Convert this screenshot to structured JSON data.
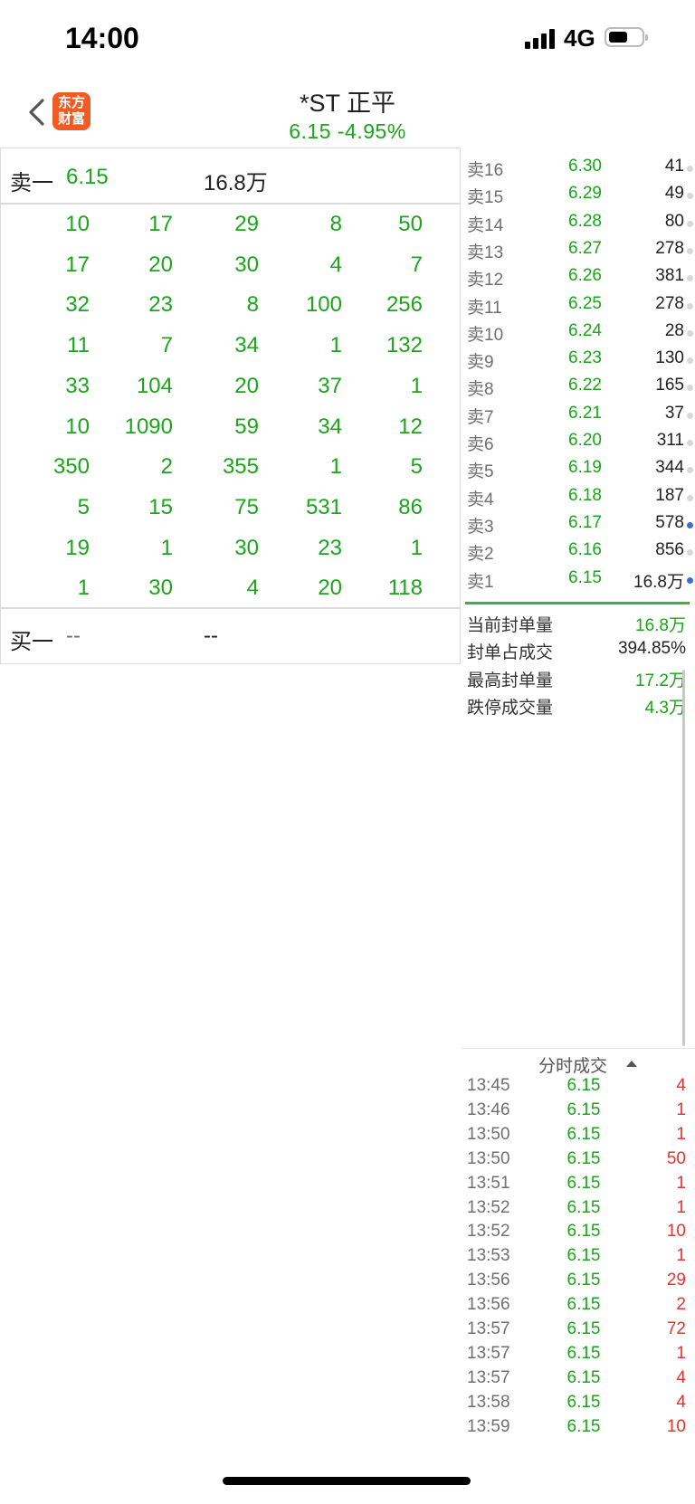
{
  "status_bar": {
    "time": "14:00",
    "network": "4G"
  },
  "header": {
    "title": "*ST 正平",
    "subtitle": "6.15  -4.95%",
    "logo_text_line1": "东方",
    "logo_text_line2": "财富"
  },
  "sell_one": {
    "label": "卖一",
    "price": "6.15",
    "volume": "16.8万"
  },
  "buy_one": {
    "label": "买一",
    "price": "--",
    "volume": "--"
  },
  "queue_grid": [
    [
      "10",
      "17",
      "29",
      "8",
      "50"
    ],
    [
      "17",
      "20",
      "30",
      "4",
      "7"
    ],
    [
      "32",
      "23",
      "8",
      "100",
      "256"
    ],
    [
      "11",
      "7",
      "34",
      "1",
      "132"
    ],
    [
      "33",
      "104",
      "20",
      "37",
      "1"
    ],
    [
      "10",
      "1090",
      "59",
      "34",
      "12"
    ],
    [
      "350",
      "2",
      "355",
      "1",
      "5"
    ],
    [
      "5",
      "15",
      "75",
      "531",
      "86"
    ],
    [
      "19",
      "1",
      "30",
      "23",
      "1"
    ],
    [
      "1",
      "30",
      "4",
      "20",
      "118"
    ]
  ],
  "order_book": [
    {
      "label": "卖16",
      "price": "6.30",
      "volume": "41",
      "dot": "gray"
    },
    {
      "label": "卖15",
      "price": "6.29",
      "volume": "49",
      "dot": "gray"
    },
    {
      "label": "卖14",
      "price": "6.28",
      "volume": "80",
      "dot": "gray"
    },
    {
      "label": "卖13",
      "price": "6.27",
      "volume": "278",
      "dot": "gray"
    },
    {
      "label": "卖12",
      "price": "6.26",
      "volume": "381",
      "dot": "gray"
    },
    {
      "label": "卖11",
      "price": "6.25",
      "volume": "278",
      "dot": "gray"
    },
    {
      "label": "卖10",
      "price": "6.24",
      "volume": "28",
      "dot": "gray"
    },
    {
      "label": "卖9",
      "price": "6.23",
      "volume": "130",
      "dot": "gray"
    },
    {
      "label": "卖8",
      "price": "6.22",
      "volume": "165",
      "dot": "gray"
    },
    {
      "label": "卖7",
      "price": "6.21",
      "volume": "37",
      "dot": "gray"
    },
    {
      "label": "卖6",
      "price": "6.20",
      "volume": "311",
      "dot": "gray"
    },
    {
      "label": "卖5",
      "price": "6.19",
      "volume": "344",
      "dot": "gray"
    },
    {
      "label": "卖4",
      "price": "6.18",
      "volume": "187",
      "dot": "gray"
    },
    {
      "label": "卖3",
      "price": "6.17",
      "volume": "578",
      "dot": "blue"
    },
    {
      "label": "卖2",
      "price": "6.16",
      "volume": "856",
      "dot": "gray"
    },
    {
      "label": "卖1",
      "price": "6.15",
      "volume": "16.8万",
      "dot": "blue"
    }
  ],
  "seal_stats": [
    {
      "label": "当前封单量",
      "value": "16.8万",
      "color": "green"
    },
    {
      "label": "封单占成交",
      "value": "394.85%",
      "color": "dark"
    },
    {
      "label": "最高封单量",
      "value": "17.2万",
      "color": "green"
    },
    {
      "label": "跌停成交量",
      "value": "4.3万",
      "color": "green"
    }
  ],
  "trades": {
    "title": "分时成交",
    "rows": [
      {
        "time": "13:45",
        "price": "6.15",
        "volume": "4"
      },
      {
        "time": "13:46",
        "price": "6.15",
        "volume": "1"
      },
      {
        "time": "13:50",
        "price": "6.15",
        "volume": "1"
      },
      {
        "time": "13:50",
        "price": "6.15",
        "volume": "50"
      },
      {
        "time": "13:51",
        "price": "6.15",
        "volume": "1"
      },
      {
        "time": "13:52",
        "price": "6.15",
        "volume": "1"
      },
      {
        "time": "13:52",
        "price": "6.15",
        "volume": "10"
      },
      {
        "time": "13:53",
        "price": "6.15",
        "volume": "1"
      },
      {
        "time": "13:56",
        "price": "6.15",
        "volume": "29"
      },
      {
        "time": "13:56",
        "price": "6.15",
        "volume": "2"
      },
      {
        "time": "13:57",
        "price": "6.15",
        "volume": "72"
      },
      {
        "time": "13:57",
        "price": "6.15",
        "volume": "1"
      },
      {
        "time": "13:57",
        "price": "6.15",
        "volume": "4"
      },
      {
        "time": "13:58",
        "price": "6.15",
        "volume": "4"
      },
      {
        "time": "13:59",
        "price": "6.15",
        "volume": "10"
      }
    ]
  },
  "colors": {
    "green": "#1aa51a",
    "red": "#e8322e",
    "accent_line": "#3cb34a",
    "dot_blue": "#3a6fd8",
    "logo_orange": "#f25a23"
  }
}
